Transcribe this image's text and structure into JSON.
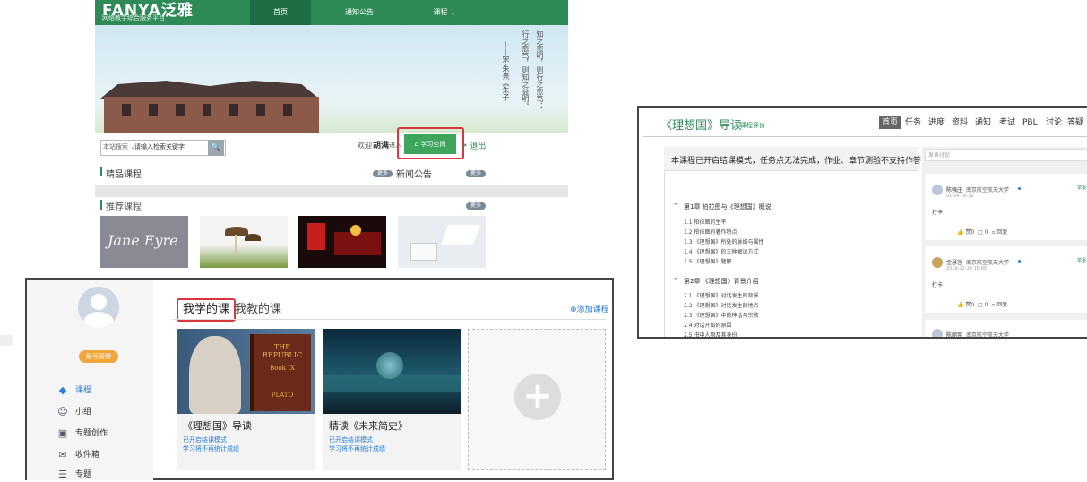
{
  "portal": {
    "logo": "FANYA泛雅",
    "logo_sub": "网络教学综合服务平台",
    "nav": [
      "首页",
      "通知公告",
      "课程 ⌄"
    ],
    "quote_lines": [
      "知之愈明，则行之愈笃；",
      "行之愈笃，则知之益明。",
      "——宋·朱熹《朱子"
    ],
    "search_scope": "本站搜索 ⌄",
    "search_placeholder": "请输入检索关键字",
    "welcome": "欢迎",
    "username": "胡满",
    "enter": "进入",
    "space_button": "学习空间",
    "logout": "退出",
    "featured": "精品课程",
    "news": "新闻公告",
    "recommended": "推荐课程",
    "more": "更多",
    "thumb_jane": "Jane Eyre"
  },
  "mycourses": {
    "account_button": "账号管理",
    "side_items": [
      "课程",
      "小组",
      "专题创作",
      "收件箱",
      "专题"
    ],
    "tab_active": "我学的课",
    "tab_other": "我教的课",
    "add_course": "添加课程",
    "cards": [
      {
        "title": "《理想国》导读",
        "line1": "已开启结课模式",
        "line2": "学习将不再统计成绩",
        "book_title": "THE REPUBLIC",
        "book_sub": "Book IX",
        "book_author": "PLATO"
      },
      {
        "title": "精读《未来简史》",
        "line1": "已开启结课模式",
        "line2": "学习将不再统计成绩"
      }
    ]
  },
  "course": {
    "title": "《理想国》导读",
    "evaluate": "课程评价",
    "nav": [
      "首页",
      "任务",
      "进度",
      "资料",
      "通知",
      "考试",
      "PBL",
      "讨论",
      "答疑"
    ],
    "notice": "本课程已开启结课模式，任务点无法完成，作业、章节测验不支持作答",
    "chapters": [
      {
        "title": "第1章 柏拉图与《理想国》概说",
        "sections": [
          "1.1 柏拉图的生平",
          "1.2 柏拉图的著作特点",
          "1.3 《理想国》所处的脉络与属性",
          "1.4 《理想国》的三种解读方式",
          "1.5 《理想国》题解"
        ]
      },
      {
        "title": "第2章 《理想国》背景介绍",
        "sections": [
          "2.1 《理想国》对话发生的背景",
          "2.2 《理想国》对话发生的地点",
          "2.3 《理想国》中的神话与宗教",
          "2.4 对话开始的原因",
          "2.5 书中人物及其身份"
        ]
      }
    ],
    "comment_placeholder": "发表讨论",
    "comments": [
      {
        "name": "陈强庄",
        "school": "南京航空航天大学",
        "date": "01-04 16:32",
        "text": "打卡",
        "like": "赞0",
        "reply_count": "0",
        "reply": "回复",
        "tag": "举报"
      },
      {
        "name": "金慧容",
        "school": "南京航空航天大学",
        "date": "2019-12-24 16:00",
        "text": "打卡",
        "like": "赞0",
        "reply_count": "0",
        "reply": "回复",
        "tag": "举报"
      },
      {
        "name": "陈丽宪",
        "school": "南京航空航天大学"
      }
    ]
  }
}
